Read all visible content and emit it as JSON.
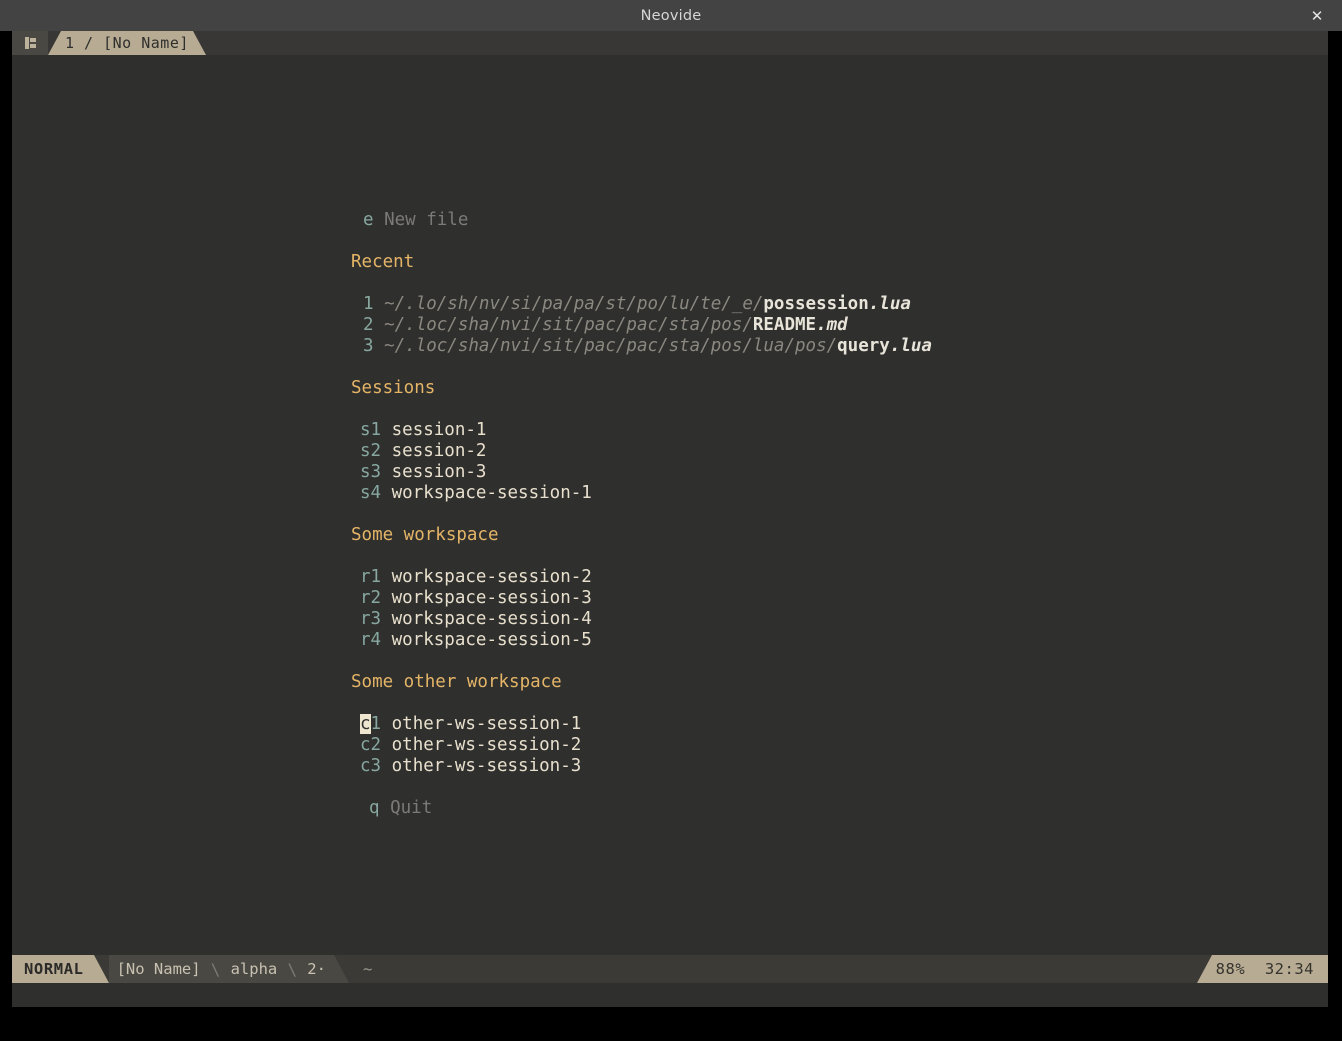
{
  "window": {
    "title": "Neovide",
    "close_label": "✕",
    "close_icon": "close-icon"
  },
  "tabline": {
    "icon": "neovim-logo-icon",
    "active_tab": "1 / [No Name]"
  },
  "dashboard": {
    "top_action": {
      "key": "e",
      "label": "New file"
    },
    "sections": [
      {
        "title": "Recent",
        "type": "files",
        "items": [
          {
            "key": "1",
            "path": "~/.lo/sh/nv/si/pa/pa/st/po/lu/te/_e/",
            "name": "possession",
            "ext": ".lua"
          },
          {
            "key": "2",
            "path": "~/.loc/sha/nvi/sit/pac/pac/sta/pos/",
            "name": "README",
            "ext": ".md"
          },
          {
            "key": "3",
            "path": "~/.loc/sha/nvi/sit/pac/pac/sta/pos/lua/pos/",
            "name": "query",
            "ext": ".lua"
          }
        ]
      },
      {
        "title": "Sessions",
        "type": "sessions",
        "items": [
          {
            "key": "s1",
            "label": "session-1"
          },
          {
            "key": "s2",
            "label": "session-2"
          },
          {
            "key": "s3",
            "label": "session-3"
          },
          {
            "key": "s4",
            "label": "workspace-session-1"
          }
        ]
      },
      {
        "title": "Some workspace",
        "type": "sessions",
        "items": [
          {
            "key": "r1",
            "label": "workspace-session-2"
          },
          {
            "key": "r2",
            "label": "workspace-session-3"
          },
          {
            "key": "r3",
            "label": "workspace-session-4"
          },
          {
            "key": "r4",
            "label": "workspace-session-5"
          }
        ]
      },
      {
        "title": "Some other workspace",
        "type": "sessions",
        "items": [
          {
            "key": "c1",
            "label": "other-ws-session-1",
            "cursor_on_first_char": true
          },
          {
            "key": "c2",
            "label": "other-ws-session-2"
          },
          {
            "key": "c3",
            "label": "other-ws-session-3"
          }
        ]
      }
    ],
    "bottom_action": {
      "key": "q",
      "label": "Quit"
    }
  },
  "statusline": {
    "mode": "NORMAL",
    "file": "[No Name]",
    "filetype": "alpha",
    "lines": "2·",
    "tilde": "~",
    "separator": "\\",
    "percent": "88%",
    "position": "32:34"
  },
  "colors": {
    "background": "#2f2f2e",
    "accent": "#b7ac93",
    "header": "#e5b567",
    "key": "#87a7a0",
    "session": "#e8e0cd",
    "dim": "#7b7a76",
    "cursor": "#efe6d0"
  }
}
